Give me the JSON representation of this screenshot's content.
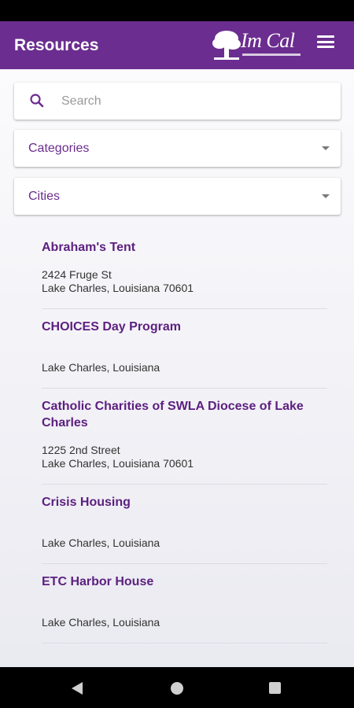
{
  "header": {
    "title": "Resources",
    "logo_text": "Im Cal",
    "menu_icon": "hamburger-menu-icon"
  },
  "search": {
    "placeholder": "Search",
    "value": "",
    "icon": "search-icon"
  },
  "filters": {
    "categories_label": "Categories",
    "cities_label": "Cities"
  },
  "resources": [
    {
      "name": "Abraham's Tent",
      "line1": "2424 Fruge St",
      "line2": "Lake Charles, Louisiana 70601"
    },
    {
      "name": "CHOICES Day Program",
      "line1": "",
      "line2": "Lake Charles, Louisiana"
    },
    {
      "name": "Catholic Charities of SWLA Diocese of Lake Charles",
      "line1": "1225 2nd Street",
      "line2": "Lake Charles, Louisiana 70601"
    },
    {
      "name": "Crisis Housing",
      "line1": "",
      "line2": "Lake Charles, Louisiana"
    },
    {
      "name": "ETC Harbor House",
      "line1": "",
      "line2": "Lake Charles, Louisiana"
    }
  ],
  "colors": {
    "brand": "#6b2d8f",
    "item_title": "#5c1f7f",
    "background": "#f3f3f7"
  }
}
